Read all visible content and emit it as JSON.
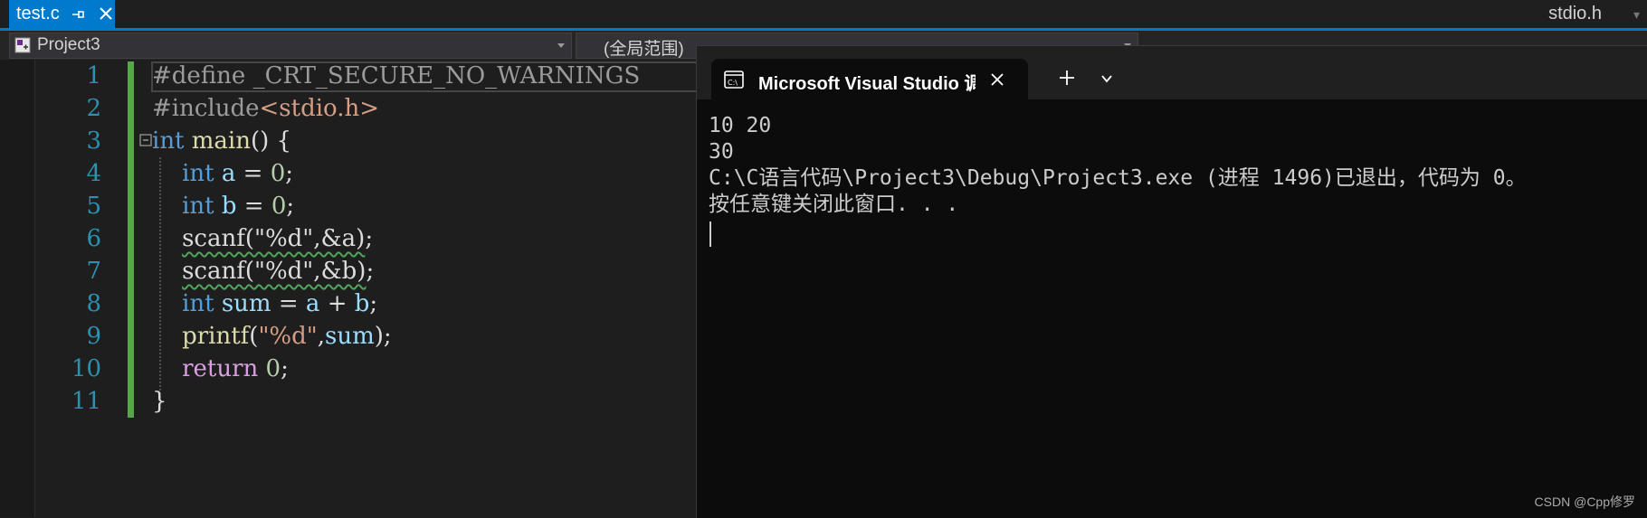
{
  "tabs": {
    "active": {
      "title": "test.c",
      "pin_icon": "pin-icon",
      "close_icon": "close-icon"
    },
    "right_tab": "stdio.h"
  },
  "navbar": {
    "project_selector": "Project3",
    "scope_selector": "(全局范围)"
  },
  "editor": {
    "line_numbers": [
      "1",
      "2",
      "3",
      "4",
      "5",
      "6",
      "7",
      "8",
      "9",
      "10",
      "11"
    ],
    "lines": [
      {
        "tokens": [
          [
            "#define ",
            "pp"
          ],
          [
            "_CRT_SECURE_NO_WARNINGS",
            "pp"
          ]
        ]
      },
      {
        "tokens": [
          [
            "#include",
            "pp"
          ],
          [
            "<stdio.h>",
            "incl"
          ]
        ]
      },
      {
        "tokens": [
          [
            "int",
            "kw"
          ],
          [
            " ",
            ""
          ],
          [
            "main",
            "fn"
          ],
          [
            "() {",
            ""
          ]
        ]
      },
      {
        "tokens": [
          [
            "    ",
            ""
          ],
          [
            "int",
            "kw"
          ],
          [
            " ",
            ""
          ],
          [
            "a",
            "var"
          ],
          [
            " = ",
            ""
          ],
          [
            "0",
            "num"
          ],
          [
            ";",
            ""
          ]
        ]
      },
      {
        "tokens": [
          [
            "    ",
            ""
          ],
          [
            "int",
            "kw"
          ],
          [
            " ",
            ""
          ],
          [
            "b",
            "var"
          ],
          [
            " = ",
            ""
          ],
          [
            "0",
            "num"
          ],
          [
            ";",
            ""
          ]
        ]
      },
      {
        "tokens": [
          [
            "    ",
            ""
          ],
          [
            "scanf(\"%d\",&a)",
            "squig"
          ],
          [
            ";",
            ""
          ]
        ]
      },
      {
        "tokens": [
          [
            "    ",
            ""
          ],
          [
            "scanf(\"%d\",&b)",
            "squig"
          ],
          [
            ";",
            ""
          ]
        ]
      },
      {
        "tokens": [
          [
            "    ",
            ""
          ],
          [
            "int",
            "kw"
          ],
          [
            " ",
            ""
          ],
          [
            "sum",
            "var"
          ],
          [
            " = ",
            ""
          ],
          [
            "a",
            "var"
          ],
          [
            " + ",
            ""
          ],
          [
            "b",
            "var"
          ],
          [
            ";",
            ""
          ]
        ]
      },
      {
        "tokens": [
          [
            "    ",
            ""
          ],
          [
            "printf",
            "fn"
          ],
          [
            "(",
            ""
          ],
          [
            "\"%d\"",
            "str"
          ],
          [
            ",",
            ""
          ],
          [
            "sum",
            "var"
          ],
          [
            ");",
            ""
          ]
        ]
      },
      {
        "tokens": [
          [
            "    ",
            ""
          ],
          [
            "return",
            "ret"
          ],
          [
            " ",
            ""
          ],
          [
            "0",
            "num"
          ],
          [
            ";",
            ""
          ]
        ]
      },
      {
        "tokens": [
          [
            "}",
            ""
          ]
        ]
      }
    ]
  },
  "terminal": {
    "tab_title": "Microsoft Visual Studio 调试控制台",
    "output": [
      "10 20",
      "30",
      "C:\\C语言代码\\Project3\\Debug\\Project3.exe (进程 1496)已退出，代码为 0。",
      "按任意键关闭此窗口. . ."
    ]
  },
  "watermark": "CSDN @Cpp修罗",
  "colors": {
    "accent": "#007acc",
    "change_bar": "#57a64a",
    "line_number": "#2b91af",
    "keyword": "#569cd6",
    "function": "#dcdcaa",
    "variable": "#9cdcfe",
    "number": "#b5cea8",
    "string": "#d69d85",
    "control": "#d8a0df"
  }
}
